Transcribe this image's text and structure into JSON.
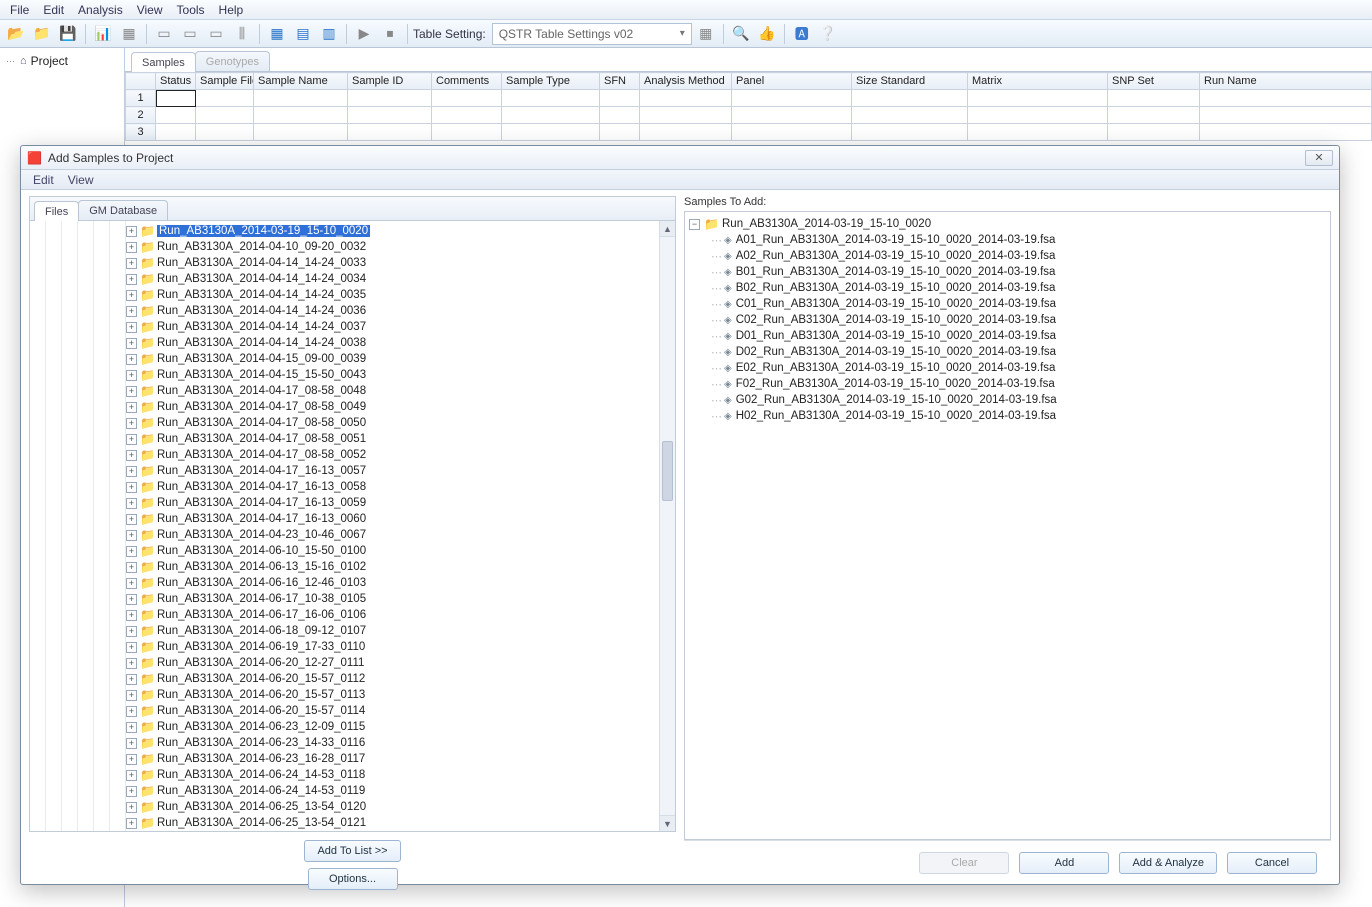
{
  "menu": {
    "items": [
      "File",
      "Edit",
      "Analysis",
      "View",
      "Tools",
      "Help"
    ]
  },
  "toolbar": {
    "table_setting_label": "Table Setting:",
    "table_setting_value": "QSTR Table Settings v02"
  },
  "project": {
    "node_label": "Project"
  },
  "tabs": {
    "samples": "Samples",
    "genotypes": "Genotypes"
  },
  "grid": {
    "columns": [
      "Status",
      "Sample File",
      "Sample Name",
      "Sample ID",
      "Comments",
      "Sample Type",
      "SFN",
      "Analysis Method",
      "Panel",
      "Size Standard",
      "Matrix",
      "SNP Set",
      "Run Name"
    ],
    "rows": [
      "1",
      "2",
      "3"
    ]
  },
  "dialog": {
    "title": "Add Samples to Project",
    "menu": [
      "Edit",
      "View"
    ],
    "left_tabs": {
      "files": "Files",
      "gmdb": "GM Database"
    },
    "add_to_list": "Add To List >>",
    "options": "Options...",
    "samples_to_add": "Samples To Add:",
    "btn_clear": "Clear",
    "btn_add": "Add",
    "btn_add_analyze": "Add & Analyze",
    "btn_cancel": "Cancel"
  },
  "folders": [
    "Run_AB3130A_2014-03-19_15-10_0020",
    "Run_AB3130A_2014-04-10_09-20_0032",
    "Run_AB3130A_2014-04-14_14-24_0033",
    "Run_AB3130A_2014-04-14_14-24_0034",
    "Run_AB3130A_2014-04-14_14-24_0035",
    "Run_AB3130A_2014-04-14_14-24_0036",
    "Run_AB3130A_2014-04-14_14-24_0037",
    "Run_AB3130A_2014-04-14_14-24_0038",
    "Run_AB3130A_2014-04-15_09-00_0039",
    "Run_AB3130A_2014-04-15_15-50_0043",
    "Run_AB3130A_2014-04-17_08-58_0048",
    "Run_AB3130A_2014-04-17_08-58_0049",
    "Run_AB3130A_2014-04-17_08-58_0050",
    "Run_AB3130A_2014-04-17_08-58_0051",
    "Run_AB3130A_2014-04-17_08-58_0052",
    "Run_AB3130A_2014-04-17_16-13_0057",
    "Run_AB3130A_2014-04-17_16-13_0058",
    "Run_AB3130A_2014-04-17_16-13_0059",
    "Run_AB3130A_2014-04-17_16-13_0060",
    "Run_AB3130A_2014-04-23_10-46_0067",
    "Run_AB3130A_2014-06-10_15-50_0100",
    "Run_AB3130A_2014-06-13_15-16_0102",
    "Run_AB3130A_2014-06-16_12-46_0103",
    "Run_AB3130A_2014-06-17_10-38_0105",
    "Run_AB3130A_2014-06-17_16-06_0106",
    "Run_AB3130A_2014-06-18_09-12_0107",
    "Run_AB3130A_2014-06-19_17-33_0110",
    "Run_AB3130A_2014-06-20_12-27_0111",
    "Run_AB3130A_2014-06-20_15-57_0112",
    "Run_AB3130A_2014-06-20_15-57_0113",
    "Run_AB3130A_2014-06-20_15-57_0114",
    "Run_AB3130A_2014-06-23_12-09_0115",
    "Run_AB3130A_2014-06-23_14-33_0116",
    "Run_AB3130A_2014-06-23_16-28_0117",
    "Run_AB3130A_2014-06-24_14-53_0118",
    "Run_AB3130A_2014-06-24_14-53_0119",
    "Run_AB3130A_2014-06-25_13-54_0120",
    "Run_AB3130A_2014-06-25_13-54_0121"
  ],
  "samples_root": "Run_AB3130A_2014-03-19_15-10_0020",
  "samples": [
    "A01_Run_AB3130A_2014-03-19_15-10_0020_2014-03-19.fsa",
    "A02_Run_AB3130A_2014-03-19_15-10_0020_2014-03-19.fsa",
    "B01_Run_AB3130A_2014-03-19_15-10_0020_2014-03-19.fsa",
    "B02_Run_AB3130A_2014-03-19_15-10_0020_2014-03-19.fsa",
    "C01_Run_AB3130A_2014-03-19_15-10_0020_2014-03-19.fsa",
    "C02_Run_AB3130A_2014-03-19_15-10_0020_2014-03-19.fsa",
    "D01_Run_AB3130A_2014-03-19_15-10_0020_2014-03-19.fsa",
    "D02_Run_AB3130A_2014-03-19_15-10_0020_2014-03-19.fsa",
    "E02_Run_AB3130A_2014-03-19_15-10_0020_2014-03-19.fsa",
    "F02_Run_AB3130A_2014-03-19_15-10_0020_2014-03-19.fsa",
    "G02_Run_AB3130A_2014-03-19_15-10_0020_2014-03-19.fsa",
    "H02_Run_AB3130A_2014-03-19_15-10_0020_2014-03-19.fsa"
  ]
}
